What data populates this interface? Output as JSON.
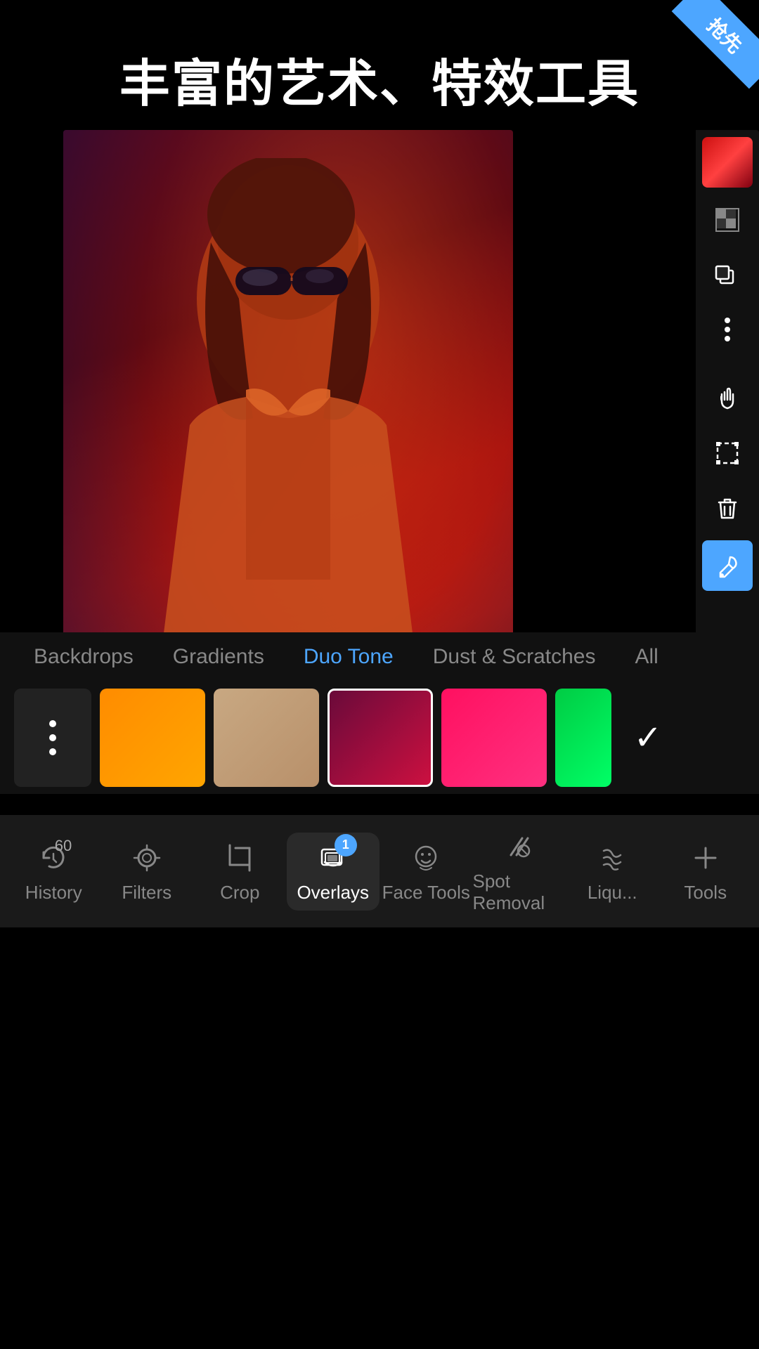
{
  "header": {
    "title": "丰富的艺术、特效工具",
    "badge_text": "抢先"
  },
  "categories": [
    {
      "label": "Backdrops",
      "active": false
    },
    {
      "label": "Gradients",
      "active": false
    },
    {
      "label": "Duo Tone",
      "active": true
    },
    {
      "label": "Dust & Scratches",
      "active": false
    },
    {
      "label": "All",
      "active": false
    }
  ],
  "swatches": [
    {
      "type": "dots",
      "label": "more"
    },
    {
      "type": "color",
      "label": "orange"
    },
    {
      "type": "color",
      "label": "tan"
    },
    {
      "type": "color",
      "label": "red-purple"
    },
    {
      "type": "color",
      "label": "hot-pink"
    },
    {
      "type": "color",
      "label": "green"
    },
    {
      "type": "check",
      "label": "confirm"
    }
  ],
  "bottom_nav": [
    {
      "id": "history",
      "label": "History",
      "icon": "history",
      "count": "60",
      "active": false
    },
    {
      "id": "filters",
      "label": "Filters",
      "icon": "filters",
      "active": false
    },
    {
      "id": "crop",
      "label": "Crop",
      "icon": "crop",
      "active": false
    },
    {
      "id": "overlays",
      "label": "Overlays",
      "icon": "overlays",
      "active": true,
      "badge": "1"
    },
    {
      "id": "face-tools",
      "label": "Face Tools",
      "icon": "face",
      "active": false
    },
    {
      "id": "spot-removal",
      "label": "Spot Removal",
      "icon": "spot",
      "active": false
    },
    {
      "id": "liquify",
      "label": "Liqu...",
      "icon": "liquify",
      "active": false
    },
    {
      "id": "tools",
      "label": "Tools",
      "icon": "plus",
      "active": false
    }
  ],
  "right_tools": [
    {
      "id": "color-swatch",
      "type": "color"
    },
    {
      "id": "checkerboard",
      "icon": "checkerboard"
    },
    {
      "id": "duplicate",
      "icon": "duplicate"
    },
    {
      "id": "more",
      "icon": "more"
    },
    {
      "id": "hand",
      "icon": "hand"
    },
    {
      "id": "transform",
      "icon": "transform"
    },
    {
      "id": "delete",
      "icon": "delete"
    },
    {
      "id": "eyedropper",
      "icon": "eyedropper",
      "accent": true
    }
  ]
}
